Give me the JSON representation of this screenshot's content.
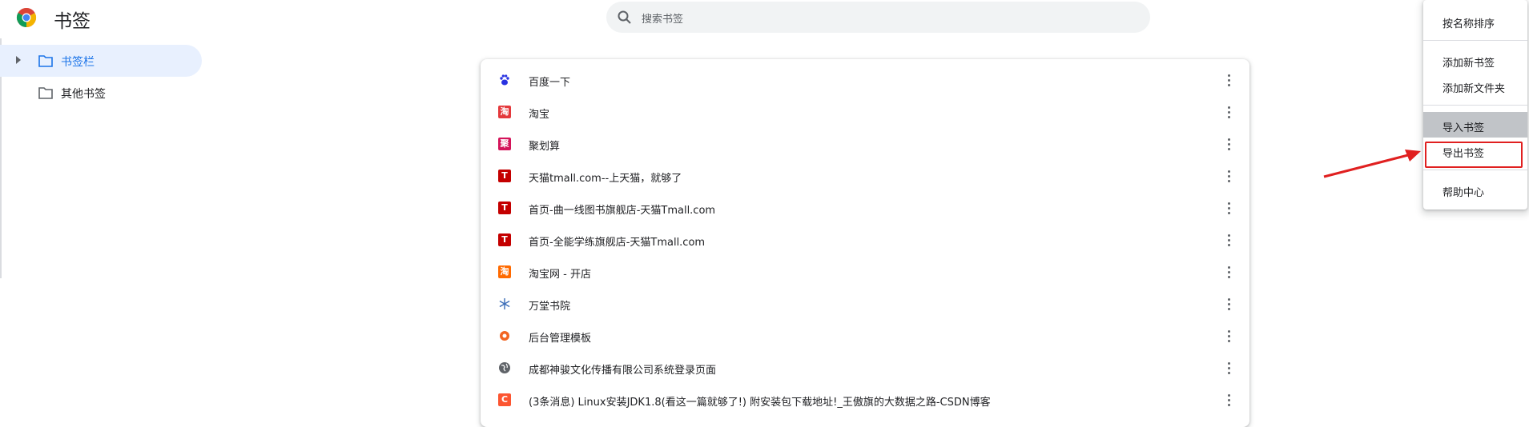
{
  "app": {
    "title": "书签"
  },
  "search": {
    "placeholder": "搜索书签"
  },
  "sidebar": {
    "items": [
      {
        "label": "书签栏",
        "active": true
      },
      {
        "label": "其他书签",
        "active": false
      }
    ]
  },
  "bookmarks": [
    {
      "title": "百度一下",
      "icon": "baidu-paw-icon",
      "color": "#2932e1"
    },
    {
      "title": "淘宝",
      "icon": "taobao-icon",
      "color": "#e4393c"
    },
    {
      "title": "聚划算",
      "icon": "juhuasuan-icon",
      "color": "#d4145a"
    },
    {
      "title": "天猫tmall.com--上天猫，就够了",
      "icon": "tmall-icon",
      "color": "#c40000"
    },
    {
      "title": "首页-曲一线图书旗舰店-天猫Tmall.com",
      "icon": "tmall-icon",
      "color": "#c40000"
    },
    {
      "title": "首页-全能学练旗舰店-天猫Tmall.com",
      "icon": "tmall-icon",
      "color": "#c40000"
    },
    {
      "title": "淘宝网 - 开店",
      "icon": "taobao-icon",
      "color": "#ff6a00"
    },
    {
      "title": "万堂书院",
      "icon": "snowflake-icon",
      "color": "#3b6cb7"
    },
    {
      "title": "后台管理模板",
      "icon": "orange-logo-icon",
      "color": "#f26522"
    },
    {
      "title": "成都神骏文化传播有限公司系统登录页面",
      "icon": "globe-icon",
      "color": "#5f6368"
    },
    {
      "title": "(3条消息) Linux安装JDK1.8(看这一篇就够了!) 附安装包下载地址!_王傲旗的大数据之路-CSDN博客",
      "icon": "csdn-icon",
      "color": "#fc5531"
    }
  ],
  "menu": {
    "items": [
      {
        "label": "按名称排序"
      },
      {
        "label": "添加新书签"
      },
      {
        "label": "添加新文件夹"
      },
      {
        "label": "导入书签"
      },
      {
        "label": "导出书签"
      },
      {
        "label": "帮助中心"
      }
    ]
  },
  "fav_glyphs": {
    "taobao": "淘",
    "juhuasuan": "聚",
    "tmall": "T",
    "csdn": "C"
  },
  "colors": {
    "accent": "#1a73e8",
    "highlight_box": "#e02020",
    "active_bg": "#e8f0fe"
  }
}
